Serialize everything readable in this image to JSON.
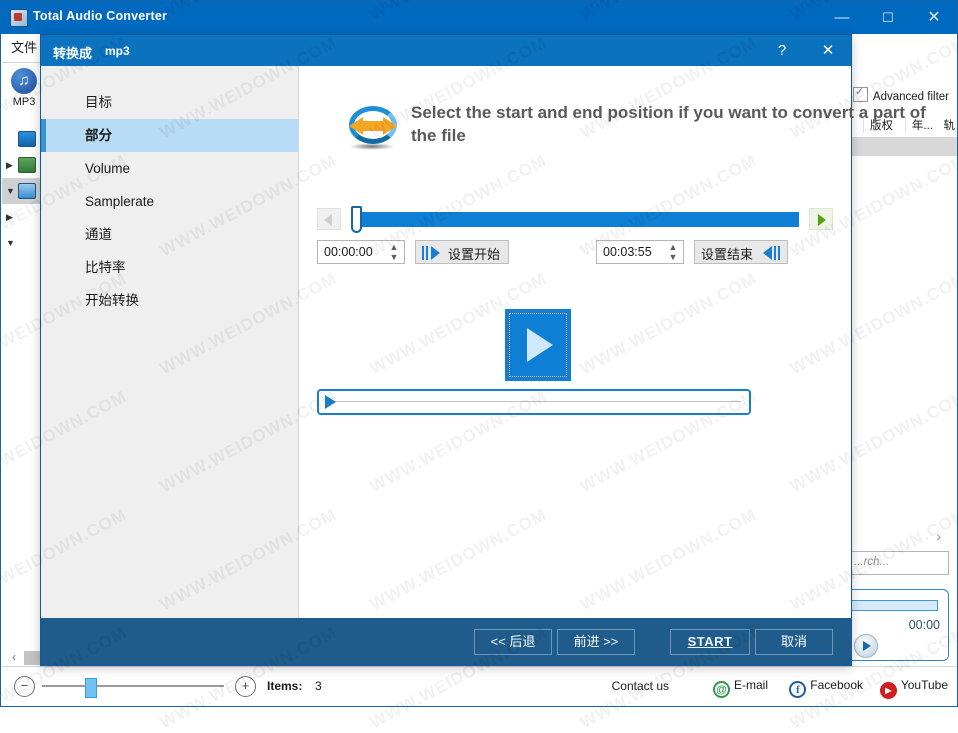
{
  "app": {
    "title": "Total Audio Converter",
    "icon": "app-icon",
    "window_buttons": {
      "minimize": "—",
      "maximize": "☐",
      "close": "✕"
    },
    "rail": {
      "file_tab": "文件",
      "mp3_label": "MP3",
      "mp3_icon": "music-note-icon",
      "tree": [
        {
          "icon": "monitor-icon",
          "expander": ""
        },
        {
          "icon": "user-icon",
          "expander": "▶"
        },
        {
          "icon": "computer-icon",
          "expander": "▼",
          "selected": true
        },
        {
          "icon": "folder-icon",
          "expander": "▶"
        },
        {
          "icon": "folder-icon",
          "expander": "▼"
        }
      ]
    },
    "advanced_filter": {
      "label": "Advanced filter",
      "checked": true
    },
    "columns": [
      "版权",
      "年...",
      "轨"
    ],
    "chevron": "›",
    "search": {
      "value": "",
      "placeholder": "...rch..."
    },
    "player": {
      "time": "00:00",
      "play_icon": "play-icon"
    },
    "status": {
      "zoom_out": "−",
      "zoom_in": "+",
      "items_label": "Items:",
      "items_count": "3",
      "contact_us": "Contact us",
      "social": [
        {
          "name": "E-mail",
          "glyph": "@",
          "color": "#2e9b4f"
        },
        {
          "name": "Facebook",
          "glyph": "f",
          "color": "#1c5ea8"
        },
        {
          "name": "YouTube",
          "glyph": "▶",
          "color": "#cf2020"
        }
      ]
    },
    "hscroll_arrow": "‹"
  },
  "dialog": {
    "title_main": "转换成",
    "title_sub": "mp3",
    "help_button": "?",
    "close_button": "✕",
    "sidebar": [
      {
        "label": "目标",
        "active": false
      },
      {
        "label": "部分",
        "active": true
      },
      {
        "label": "Volume",
        "active": false
      },
      {
        "label": "Samplerate",
        "active": false
      },
      {
        "label": "通道",
        "active": false
      },
      {
        "label": "比特率",
        "active": false
      },
      {
        "label": "开始转换",
        "active": false
      }
    ],
    "heading": "Select the start and end position if you want to convert a part of the file",
    "heading_icon": "two-way-arrows-icon",
    "trackbar": {
      "left_arrow_icon": "arrow-left-icon",
      "right_arrow_icon": "arrow-right-icon",
      "position_percent": 0
    },
    "start": {
      "value": "00:00:00",
      "button_label": "设置开始",
      "button_icon": "set-start-icon"
    },
    "end": {
      "value": "00:03:55",
      "button_label": "设置结束",
      "button_icon": "set-end-icon"
    },
    "play_button_icon": "play-icon",
    "seek_cursor_icon": "seek-cursor-icon",
    "footer": {
      "back": "<< 后退",
      "next": "前进 >>",
      "start": "START",
      "cancel": "取消"
    }
  },
  "watermark": "WWW.WEIDOWN.COM",
  "colors": {
    "title_bar": "#0069c0",
    "dialog_title": "#0b72bf",
    "dialog_footer": "#1f5c8b",
    "accent": "#0e7fd4",
    "sidebar_bg": "#efefef",
    "selection": "#b8dcf6"
  }
}
